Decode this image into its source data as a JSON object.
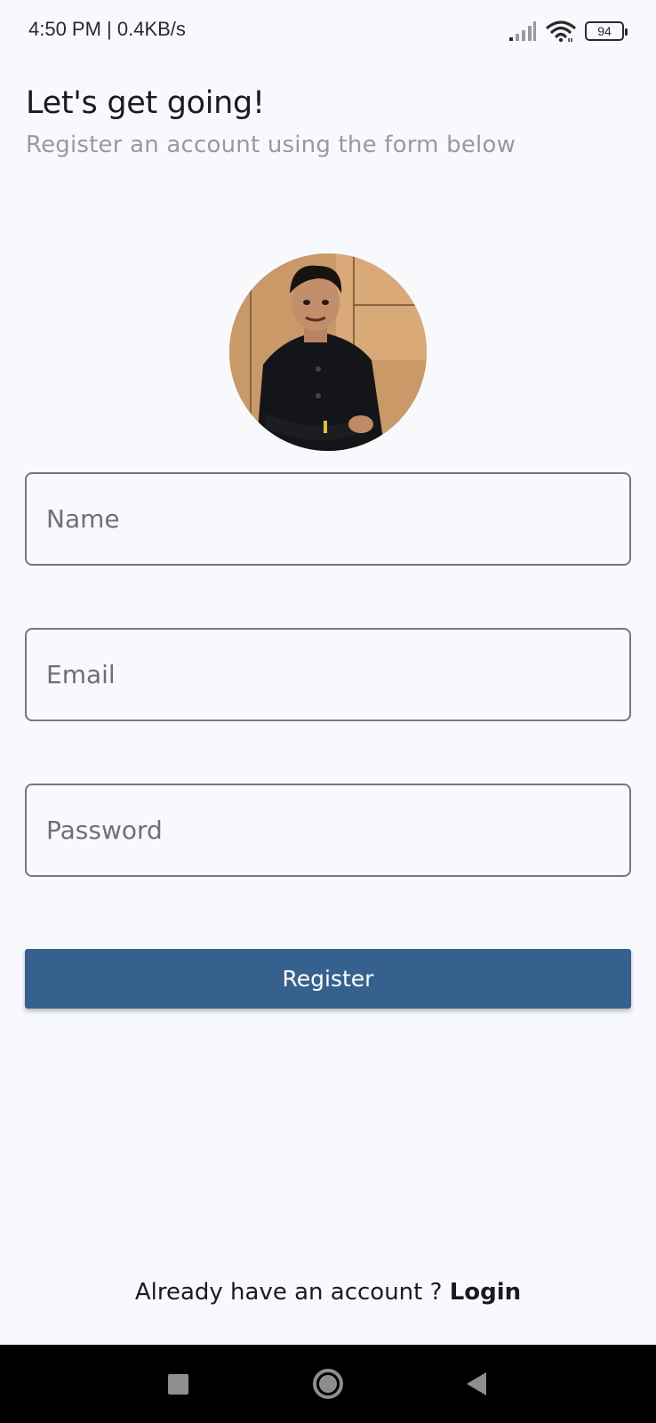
{
  "status_bar": {
    "time_speed": "4:50 PM | 0.4KB/s",
    "battery": "94",
    "icons": [
      "signal-icon",
      "wifi-icon",
      "battery-icon"
    ]
  },
  "header": {
    "title": "Let's get going!",
    "subtitle": "Register an account using the form below"
  },
  "avatar": {
    "description_icon": "profile-photo"
  },
  "form": {
    "name_placeholder": "Name",
    "email_placeholder": "Email",
    "password_placeholder": "Password",
    "register_label": "Register"
  },
  "footer": {
    "prompt": "Already have an account ? ",
    "login_label": "Login"
  },
  "nav": {
    "icons": [
      "recents-icon",
      "home-icon",
      "back-icon"
    ]
  },
  "colors": {
    "background": "#f8f9fc",
    "primary": "#36618e",
    "subtitle": "#9a9a9e",
    "field_border": "#76777c"
  }
}
